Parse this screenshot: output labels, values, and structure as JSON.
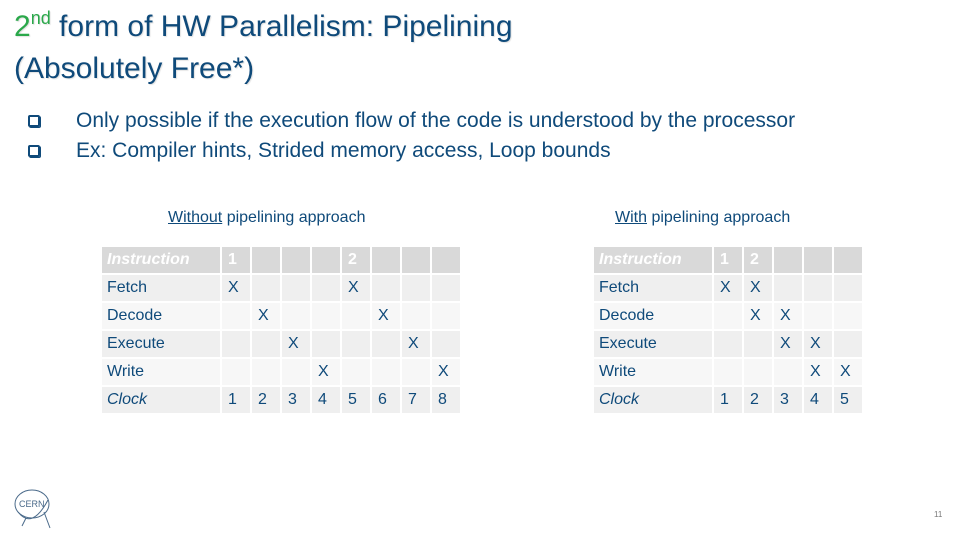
{
  "slide": {
    "title": {
      "accent_prefix": "2",
      "accent_superscript": "nd",
      "line1_rest": " form of HW Parallelism: Pipelining",
      "line2": "(Absolutely Free*)"
    },
    "bullets": [
      {
        "icon": "checkbox-bullet-icon",
        "text": "Only possible if the execution flow of the code is understood by the processor"
      },
      {
        "icon": "checkbox-bullet-icon",
        "text": "Ex: Compiler hints, Strided memory access, Loop bounds"
      }
    ],
    "colors": {
      "title": "#0f4a7a",
      "accent": "#2aa84a",
      "header_bg": "#d9d9d9",
      "row_bg_a": "#efefef",
      "row_bg_b": "#f7f7f7"
    },
    "left_table": {
      "caption_underlined": "Without",
      "caption_rest": " pipelining approach",
      "header": [
        "Instruction",
        "1",
        "",
        "",
        "",
        "2",
        "",
        "",
        ""
      ],
      "rows": [
        [
          "Fetch",
          "X",
          "",
          "",
          "",
          "X",
          "",
          "",
          ""
        ],
        [
          "Decode",
          "",
          "X",
          "",
          "",
          "",
          "X",
          "",
          ""
        ],
        [
          "Execute",
          "",
          "",
          "X",
          "",
          "",
          "",
          "X",
          ""
        ],
        [
          "Write",
          "",
          "",
          "",
          "X",
          "",
          "",
          "",
          "X"
        ]
      ],
      "clock": [
        "Clock",
        "1",
        "2",
        "3",
        "4",
        "5",
        "6",
        "7",
        "8"
      ]
    },
    "right_table": {
      "caption_underlined": "With",
      "caption_rest": " pipelining approach",
      "header": [
        "Instruction",
        "1",
        "2",
        "",
        "",
        ""
      ],
      "rows": [
        [
          "Fetch",
          "X",
          "X",
          "",
          "",
          ""
        ],
        [
          "Decode",
          "",
          "X",
          "X",
          "",
          ""
        ],
        [
          "Execute",
          "",
          "",
          "X",
          "X",
          ""
        ],
        [
          "Write",
          "",
          "",
          "",
          "X",
          "X"
        ]
      ],
      "clock": [
        "Clock",
        "1",
        "2",
        "3",
        "4",
        "5"
      ]
    },
    "logo": {
      "icon": "cern-logo-icon",
      "text": "CERN"
    },
    "page_number": "11"
  }
}
